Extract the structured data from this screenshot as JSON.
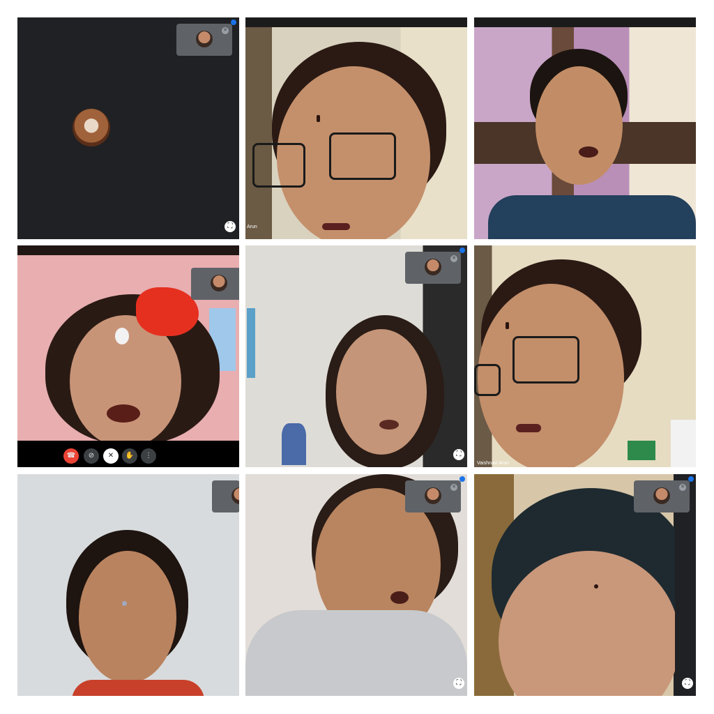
{
  "tiles": [
    {
      "id": "t1",
      "name_label": "",
      "self_view": "avatar"
    },
    {
      "id": "t2",
      "name_label": "Arun"
    },
    {
      "id": "t3",
      "name_label": ""
    },
    {
      "id": "t4",
      "name_label": ""
    },
    {
      "id": "t5",
      "name_label": ""
    },
    {
      "id": "t6",
      "name_label": "Vaishnavi Arun"
    },
    {
      "id": "t7",
      "name_label": ""
    },
    {
      "id": "t8",
      "name_label": ""
    },
    {
      "id": "t9",
      "name_label": ""
    }
  ],
  "controls": {
    "end_call_icon": "phone-hangup-icon",
    "camera_icon": "camera-off-icon",
    "mic_icon": "mic-off-icon",
    "hand_icon": "raise-hand-icon",
    "more_icon": "more-vert-icon"
  },
  "colors": {
    "meet_dark": "#202124",
    "pip_bg": "#5f6368",
    "end_call_red": "#ea4335",
    "accent_blue": "#1a73e8"
  }
}
